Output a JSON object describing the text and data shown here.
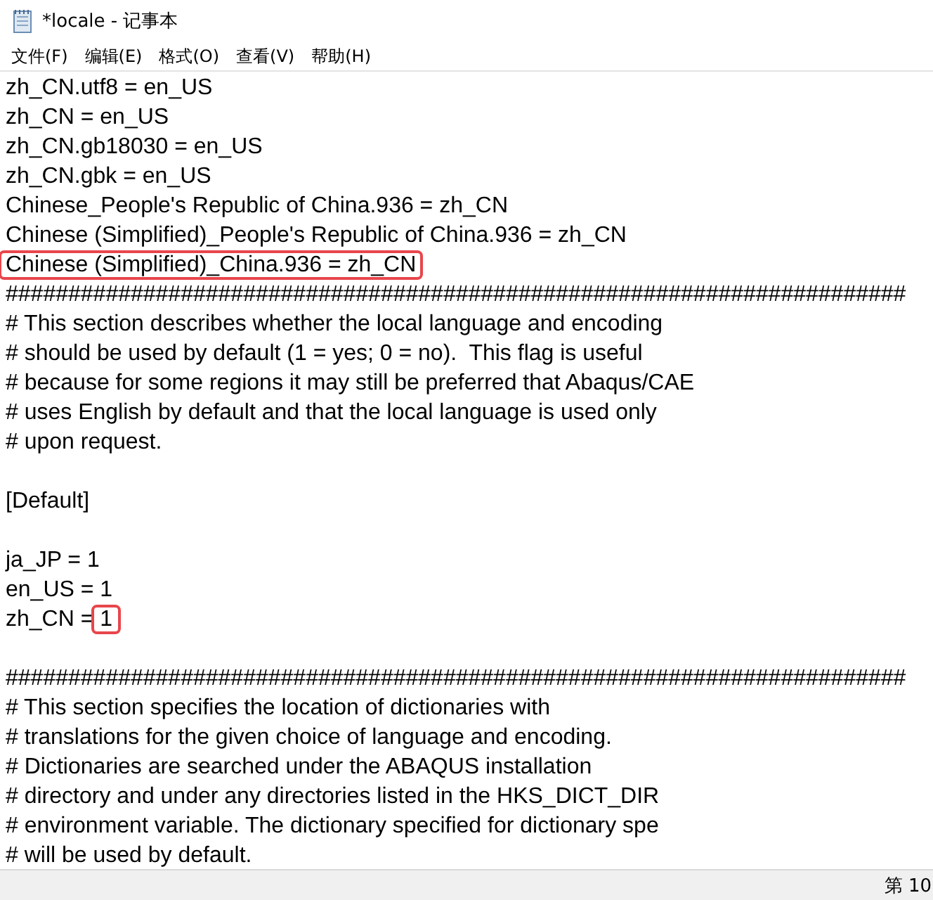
{
  "window": {
    "title": "*locale - 记事本"
  },
  "menu": [
    "文件(F)",
    "编辑(E)",
    "格式(O)",
    "查看(V)",
    "帮助(H)"
  ],
  "editor": {
    "lines": [
      {
        "kind": "text",
        "parts": [
          {
            "text": "zh_CN.utf8 = en_US",
            "boxed": false
          }
        ]
      },
      {
        "kind": "text",
        "parts": [
          {
            "text": "zh_CN = en_US",
            "boxed": false
          }
        ]
      },
      {
        "kind": "text",
        "parts": [
          {
            "text": "zh_CN.gb18030 = en_US",
            "boxed": false
          }
        ]
      },
      {
        "kind": "text",
        "parts": [
          {
            "text": "zh_CN.gbk = en_US",
            "boxed": false
          }
        ]
      },
      {
        "kind": "text",
        "parts": [
          {
            "text": "Chinese_People's Republic of China.936 = zh_CN",
            "boxed": false
          }
        ]
      },
      {
        "kind": "text",
        "parts": [
          {
            "text": "Chinese (Simplified)_People's Republic of China.936 = zh_CN",
            "boxed": false
          }
        ]
      },
      {
        "kind": "text",
        "parts": [
          {
            "text": "Chinese (Simplified)_China.936 = zh_CN",
            "boxed": true
          }
        ]
      },
      {
        "kind": "text",
        "parts": [
          {
            "text": "########################################################################",
            "boxed": false
          }
        ]
      },
      {
        "kind": "text",
        "parts": [
          {
            "text": "# This section describes whether the local language and encoding",
            "boxed": false
          }
        ]
      },
      {
        "kind": "text",
        "parts": [
          {
            "text": "# should be used by default (1 = yes; 0 = no).  This flag is useful",
            "boxed": false
          }
        ]
      },
      {
        "kind": "text",
        "parts": [
          {
            "text": "# because for some regions it may still be preferred that Abaqus/CAE",
            "boxed": false
          }
        ]
      },
      {
        "kind": "text",
        "parts": [
          {
            "text": "# uses English by default and that the local language is used only",
            "boxed": false
          }
        ]
      },
      {
        "kind": "text",
        "parts": [
          {
            "text": "# upon request.",
            "boxed": false
          }
        ]
      },
      {
        "kind": "blank"
      },
      {
        "kind": "text",
        "parts": [
          {
            "text": "[Default]",
            "boxed": false
          }
        ]
      },
      {
        "kind": "blank"
      },
      {
        "kind": "text",
        "parts": [
          {
            "text": "ja_JP = 1",
            "boxed": false
          }
        ]
      },
      {
        "kind": "text",
        "parts": [
          {
            "text": "en_US = 1",
            "boxed": false
          }
        ]
      },
      {
        "kind": "text",
        "parts": [
          {
            "text": "zh_CN = ",
            "boxed": false
          },
          {
            "text": "1",
            "boxed": true
          }
        ]
      },
      {
        "kind": "blank"
      },
      {
        "kind": "text",
        "parts": [
          {
            "text": "########################################################################",
            "boxed": false
          }
        ]
      },
      {
        "kind": "text",
        "parts": [
          {
            "text": "# This section specifies the location of dictionaries with",
            "boxed": false
          }
        ]
      },
      {
        "kind": "text",
        "parts": [
          {
            "text": "# translations for the given choice of language and encoding.",
            "boxed": false
          }
        ]
      },
      {
        "kind": "text",
        "parts": [
          {
            "text": "# Dictionaries are searched under the ABAQUS installation",
            "boxed": false
          }
        ]
      },
      {
        "kind": "text",
        "parts": [
          {
            "text": "# directory and under any directories listed in the HKS_DICT_DIR",
            "boxed": false
          }
        ]
      },
      {
        "kind": "text",
        "parts": [
          {
            "text": "# environment variable. The dictionary specified for dictionary spe",
            "boxed": false
          }
        ]
      },
      {
        "kind": "text",
        "parts": [
          {
            "text": "# will be used by default.",
            "boxed": false
          }
        ]
      }
    ]
  },
  "status_bar": {
    "position": "第 10"
  }
}
